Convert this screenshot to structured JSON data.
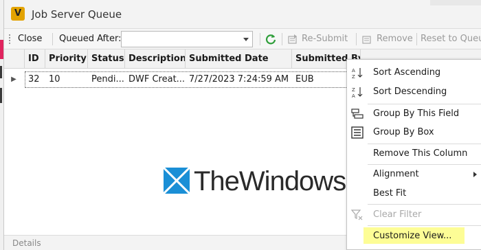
{
  "window": {
    "title": "Job Server Queue",
    "app_icon_letter": "V"
  },
  "toolbar": {
    "close_label": "Close",
    "queued_after_label": "Queued After:",
    "queued_after_value": "",
    "resubmit_label": "Re-Submit",
    "remove_label": "Remove",
    "reset_label": "Reset to Queue"
  },
  "grid": {
    "columns": [
      "ID",
      "Priority",
      "Status",
      "Description",
      "Submitted Date",
      "Submitted By"
    ],
    "rows": [
      {
        "id": "32",
        "priority": "10",
        "status": "Pendi...",
        "description": "DWF Creat...",
        "submitted_date": "7/27/2023 7:24:59 AM",
        "submitted_by": "EUB"
      }
    ]
  },
  "details": {
    "label": "Details"
  },
  "context_menu": {
    "items": [
      {
        "label": "Sort Ascending",
        "icon": "sort-ascending-icon",
        "enabled": true
      },
      {
        "label": "Sort Descending",
        "icon": "sort-descending-icon",
        "enabled": true
      },
      {
        "label": "Group By This Field",
        "icon": "group-by-field-icon",
        "enabled": true
      },
      {
        "label": "Group By Box",
        "icon": "group-by-box-icon",
        "enabled": true
      },
      {
        "label": "Remove This Column",
        "icon": "",
        "enabled": true
      },
      {
        "label": "Alignment",
        "icon": "",
        "enabled": true,
        "submenu": true
      },
      {
        "label": "Best Fit",
        "icon": "",
        "enabled": true
      },
      {
        "label": "Clear Filter",
        "icon": "clear-filter-icon",
        "enabled": false
      },
      {
        "label": "Customize View...",
        "icon": "",
        "enabled": true,
        "highlighted": true
      }
    ]
  },
  "watermark": {
    "text": "TheWindowsClub.com"
  },
  "colors": {
    "refresh_green": "#2e9e3a",
    "highlight_yellow": "#fdfd96",
    "app_icon": "#e3a300",
    "watermark_blue": "#1a8fd6"
  }
}
